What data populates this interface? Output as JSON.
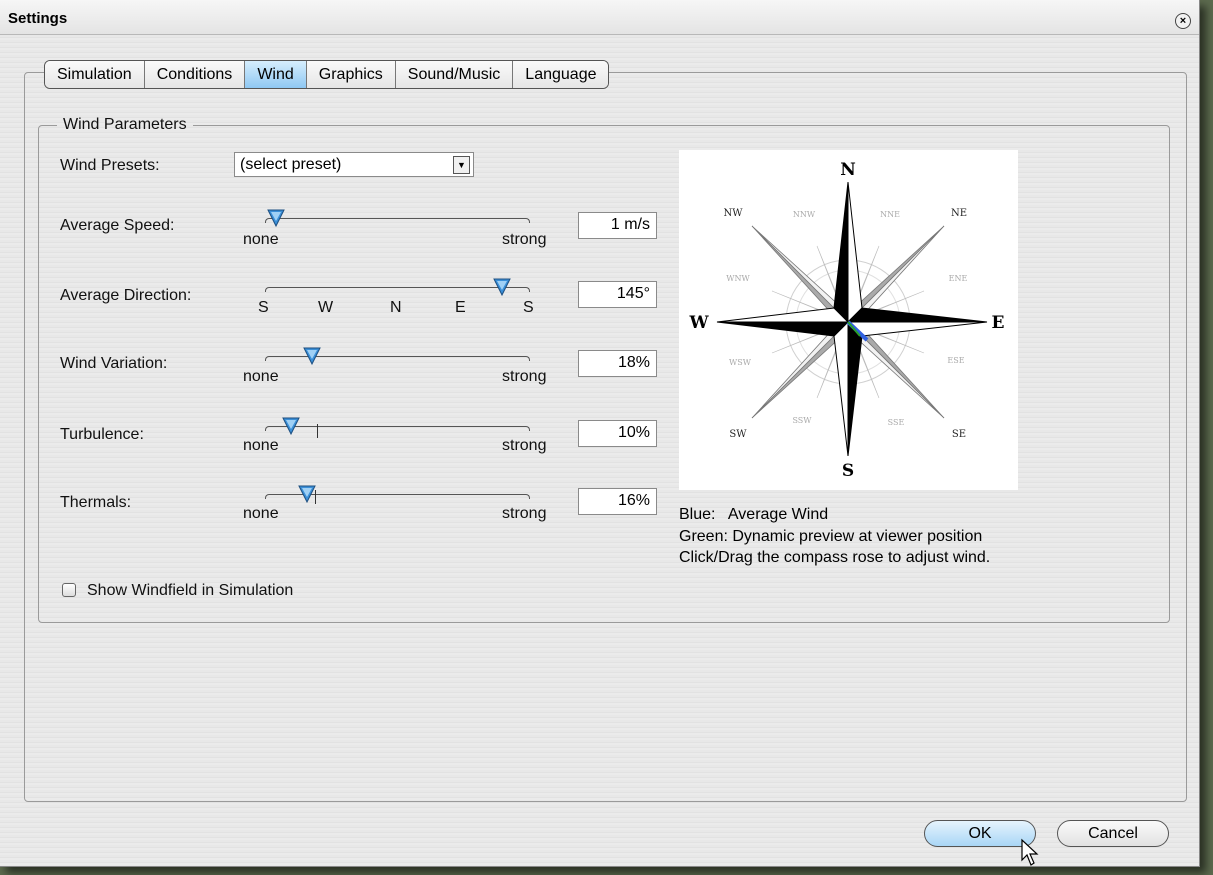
{
  "window": {
    "title": "Settings"
  },
  "tabs": [
    {
      "label": "Simulation",
      "active": false
    },
    {
      "label": "Conditions",
      "active": false
    },
    {
      "label": "Wind",
      "active": true
    },
    {
      "label": "Graphics",
      "active": false
    },
    {
      "label": "Sound/Music",
      "active": false
    },
    {
      "label": "Language",
      "active": false
    }
  ],
  "group": {
    "title": "Wind Parameters"
  },
  "presets": {
    "label": "Wind Presets:",
    "value": "(select preset)"
  },
  "sliders": {
    "speed": {
      "label": "Average Speed:",
      "min_label": "none",
      "max_label": "strong",
      "value": "1 m/s",
      "level": 0.04
    },
    "direction": {
      "label": "Average Direction:",
      "scale": [
        "S",
        "W",
        "N",
        "E",
        "S"
      ],
      "value": "145°",
      "level": 0.9
    },
    "variation": {
      "label": "Wind Variation:",
      "min_label": "none",
      "max_label": "strong",
      "value": "18%",
      "level": 0.18
    },
    "turbulence": {
      "label": "Turbulence:",
      "min_label": "none",
      "max_label": "strong",
      "value": "10%",
      "level": 0.1
    },
    "thermals": {
      "label": "Thermals:",
      "min_label": "none",
      "max_label": "strong",
      "value": "16%",
      "level": 0.16
    }
  },
  "show_windfield": {
    "label": "Show Windfield in Simulation",
    "checked": false
  },
  "compass": {
    "cardinals": [
      "N",
      "E",
      "S",
      "W"
    ],
    "intercardinals": [
      "NE",
      "SE",
      "SW",
      "NW"
    ],
    "minor": [
      "NNE",
      "ENE",
      "ESE",
      "SSE",
      "SSW",
      "WSW",
      "WNW",
      "NNW"
    ]
  },
  "legend": {
    "blue": "Blue:   Average Wind",
    "green": "Green: Dynamic preview at viewer position",
    "hint": "Click/Drag the compass rose to adjust wind."
  },
  "buttons": {
    "ok": "OK",
    "cancel": "Cancel"
  },
  "colors": {
    "active_tab": "#8fc8f3",
    "thumb": "#3a8fd8",
    "average_wind": "#3060e0",
    "preview_wind": "#2aa02a"
  }
}
